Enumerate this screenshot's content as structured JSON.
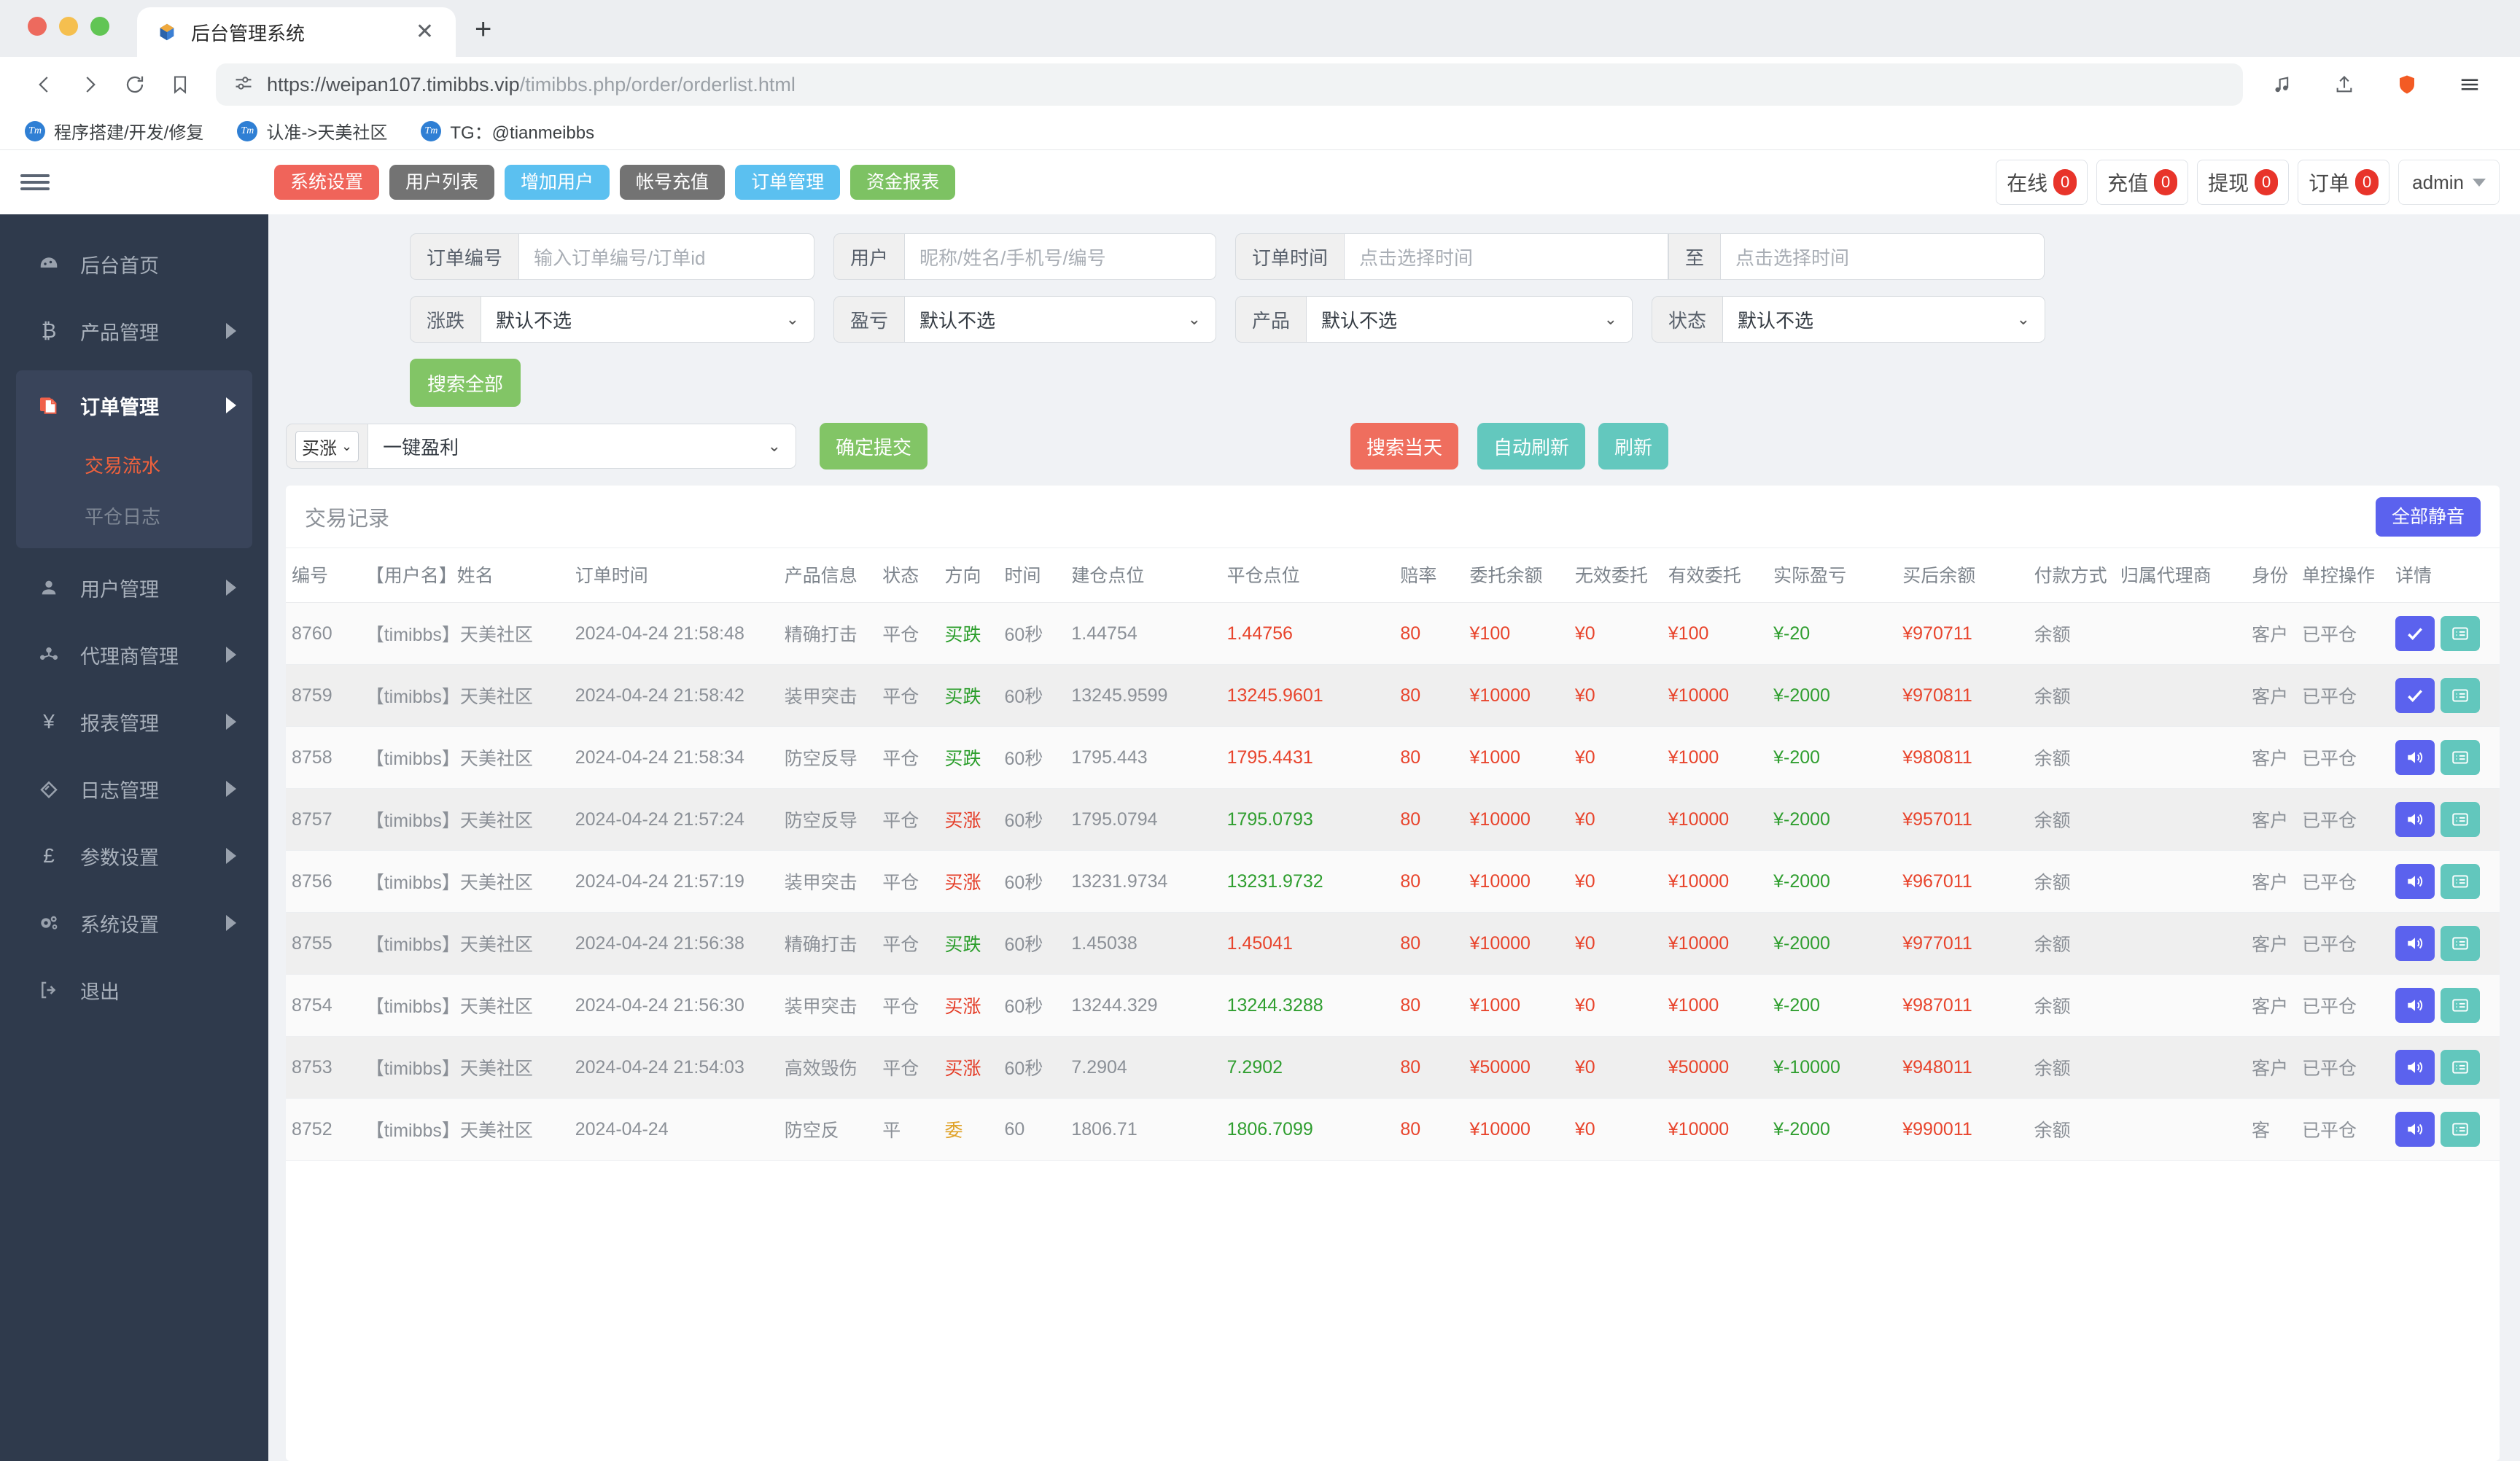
{
  "browser": {
    "tab_title": "后台管理系统",
    "tab_close": "✕",
    "new_tab": "+",
    "url_main": "https://weipan107.timibbs.vip",
    "url_path": "/timibbs.php/order/orderlist.html",
    "bookmarks": [
      {
        "icon": "Tm",
        "label": "程序搭建/开发/修复"
      },
      {
        "icon": "Tm",
        "label": "认准->天美社区"
      },
      {
        "icon": "Tm",
        "label": "TG：@tianmeibbs"
      }
    ]
  },
  "topbar": {
    "nav_buttons": [
      {
        "label": "系统设置",
        "color": "#f0645a"
      },
      {
        "label": "用户列表",
        "color": "#737373"
      },
      {
        "label": "增加用户",
        "color": "#5bc0f0"
      },
      {
        "label": "帐号充值",
        "color": "#737373"
      },
      {
        "label": "订单管理",
        "color": "#5bc0f0"
      },
      {
        "label": "资金报表",
        "color": "#7dc263"
      }
    ],
    "stats": [
      {
        "label": "在线",
        "count": "0"
      },
      {
        "label": "充值",
        "count": "0"
      },
      {
        "label": "提现",
        "count": "0"
      },
      {
        "label": "订单",
        "count": "0"
      }
    ],
    "user": "admin"
  },
  "sidebar": {
    "items": [
      {
        "icon": "dashboard-icon",
        "glyph": "◔",
        "label": "后台首页",
        "arrow": false
      },
      {
        "icon": "bitcoin-icon",
        "glyph": "₿",
        "label": "产品管理",
        "arrow": true
      }
    ],
    "group": {
      "icon": "order-icon",
      "label": "订单管理",
      "sub": [
        {
          "label": "交易流水",
          "active": true
        },
        {
          "label": "平仓日志",
          "active": false
        }
      ]
    },
    "items2": [
      {
        "icon": "user-icon",
        "glyph": "👤",
        "label": "用户管理",
        "arrow": true
      },
      {
        "icon": "agent-icon",
        "glyph": "👥",
        "label": "代理商管理",
        "arrow": true
      },
      {
        "icon": "yen-icon",
        "glyph": "¥",
        "label": "报表管理",
        "arrow": true
      },
      {
        "icon": "log-icon",
        "glyph": "◇",
        "label": "日志管理",
        "arrow": true
      },
      {
        "icon": "pound-icon",
        "glyph": "£",
        "label": "参数设置",
        "arrow": true
      },
      {
        "icon": "gear-icon",
        "glyph": "⚙",
        "label": "系统设置",
        "arrow": true
      },
      {
        "icon": "logout-icon",
        "glyph": "⇥",
        "label": "退出",
        "arrow": false
      }
    ]
  },
  "filters": {
    "order_no_label": "订单编号",
    "order_no_placeholder": "输入订单编号/订单id",
    "user_label": "用户",
    "user_placeholder": "昵称/姓名/手机号/编号",
    "time_label": "订单时间",
    "time_start_placeholder": "点击选择时间",
    "time_to_label": "至",
    "time_end_placeholder": "点击选择时间",
    "updown_label": "涨跌",
    "updown_value": "默认不选",
    "pl_label": "盈亏",
    "pl_value": "默认不选",
    "product_label": "产品",
    "product_value": "默认不选",
    "status_label": "状态",
    "status_value": "默认不选",
    "search_all": "搜索全部",
    "dir_select": "买涨",
    "bulk_select": "一键盈利",
    "confirm_submit": "确定提交",
    "search_today": "搜索当天",
    "auto_refresh": "自动刷新",
    "refresh": "刷新"
  },
  "table": {
    "title": "交易记录",
    "mute_all": "全部静音",
    "headers": [
      "编号",
      "【用户名】姓名",
      "订单时间",
      "产品信息",
      "状态",
      "方向",
      "时间",
      "建仓点位",
      "平仓点位",
      "赔率",
      "委托余额",
      "无效委托",
      "有效委托",
      "实际盈亏",
      "买后余额",
      "付款方式",
      "归属代理商",
      "身份",
      "单控操作",
      "详情"
    ],
    "rows": [
      {
        "id": "8760",
        "user": "【timibbs】天美社区",
        "time": "2024-04-24 21:58:48",
        "product": "精确打击",
        "status": "平仓",
        "direction": "买跌",
        "dir_color": "green",
        "duration": "60秒",
        "open": "1.44754",
        "close": "1.44756",
        "close_color": "red",
        "odds": "80",
        "entrust": "¥100",
        "invalid": "¥0",
        "valid": "¥100",
        "pl": "¥-20",
        "pl_color": "green",
        "balance": "¥970711",
        "pay": "余额",
        "agent": "",
        "identity": "客户",
        "control": "已平仓",
        "action_icon": "check-icon"
      },
      {
        "id": "8759",
        "user": "【timibbs】天美社区",
        "time": "2024-04-24 21:58:42",
        "product": "装甲突击",
        "status": "平仓",
        "direction": "买跌",
        "dir_color": "green",
        "duration": "60秒",
        "open": "13245.9599",
        "close": "13245.9601",
        "close_color": "red",
        "odds": "80",
        "entrust": "¥10000",
        "invalid": "¥0",
        "valid": "¥10000",
        "pl": "¥-2000",
        "pl_color": "green",
        "balance": "¥970811",
        "pay": "余额",
        "agent": "",
        "identity": "客户",
        "control": "已平仓",
        "action_icon": "check-icon"
      },
      {
        "id": "8758",
        "user": "【timibbs】天美社区",
        "time": "2024-04-24 21:58:34",
        "product": "防空反导",
        "status": "平仓",
        "direction": "买跌",
        "dir_color": "green",
        "duration": "60秒",
        "open": "1795.443",
        "close": "1795.4431",
        "close_color": "red",
        "odds": "80",
        "entrust": "¥1000",
        "invalid": "¥0",
        "valid": "¥1000",
        "pl": "¥-200",
        "pl_color": "green",
        "balance": "¥980811",
        "pay": "余额",
        "agent": "",
        "identity": "客户",
        "control": "已平仓",
        "action_icon": "speaker-icon"
      },
      {
        "id": "8757",
        "user": "【timibbs】天美社区",
        "time": "2024-04-24 21:57:24",
        "product": "防空反导",
        "status": "平仓",
        "direction": "买涨",
        "dir_color": "red",
        "duration": "60秒",
        "open": "1795.0794",
        "close": "1795.0793",
        "close_color": "green",
        "odds": "80",
        "entrust": "¥10000",
        "invalid": "¥0",
        "valid": "¥10000",
        "pl": "¥-2000",
        "pl_color": "green",
        "balance": "¥957011",
        "pay": "余额",
        "agent": "",
        "identity": "客户",
        "control": "已平仓",
        "action_icon": "speaker-icon"
      },
      {
        "id": "8756",
        "user": "【timibbs】天美社区",
        "time": "2024-04-24 21:57:19",
        "product": "装甲突击",
        "status": "平仓",
        "direction": "买涨",
        "dir_color": "red",
        "duration": "60秒",
        "open": "13231.9734",
        "close": "13231.9732",
        "close_color": "green",
        "odds": "80",
        "entrust": "¥10000",
        "invalid": "¥0",
        "valid": "¥10000",
        "pl": "¥-2000",
        "pl_color": "green",
        "balance": "¥967011",
        "pay": "余额",
        "agent": "",
        "identity": "客户",
        "control": "已平仓",
        "action_icon": "speaker-icon"
      },
      {
        "id": "8755",
        "user": "【timibbs】天美社区",
        "time": "2024-04-24 21:56:38",
        "product": "精确打击",
        "status": "平仓",
        "direction": "买跌",
        "dir_color": "green",
        "duration": "60秒",
        "open": "1.45038",
        "close": "1.45041",
        "close_color": "red",
        "odds": "80",
        "entrust": "¥10000",
        "invalid": "¥0",
        "valid": "¥10000",
        "pl": "¥-2000",
        "pl_color": "green",
        "balance": "¥977011",
        "pay": "余额",
        "agent": "",
        "identity": "客户",
        "control": "已平仓",
        "action_icon": "speaker-icon"
      },
      {
        "id": "8754",
        "user": "【timibbs】天美社区",
        "time": "2024-04-24 21:56:30",
        "product": "装甲突击",
        "status": "平仓",
        "direction": "买涨",
        "dir_color": "red",
        "duration": "60秒",
        "open": "13244.329",
        "close": "13244.3288",
        "close_color": "green",
        "odds": "80",
        "entrust": "¥1000",
        "invalid": "¥0",
        "valid": "¥1000",
        "pl": "¥-200",
        "pl_color": "green",
        "balance": "¥987011",
        "pay": "余额",
        "agent": "",
        "identity": "客户",
        "control": "已平仓",
        "action_icon": "speaker-icon"
      },
      {
        "id": "8753",
        "user": "【timibbs】天美社区",
        "time": "2024-04-24 21:54:03",
        "product": "高效毁伤",
        "status": "平仓",
        "direction": "买涨",
        "dir_color": "red",
        "duration": "60秒",
        "open": "7.2904",
        "close": "7.2902",
        "close_color": "green",
        "odds": "80",
        "entrust": "¥50000",
        "invalid": "¥0",
        "valid": "¥50000",
        "pl": "¥-10000",
        "pl_color": "green",
        "balance": "¥948011",
        "pay": "余额",
        "agent": "",
        "identity": "客户",
        "control": "已平仓",
        "action_icon": "speaker-icon"
      },
      {
        "id": "8752",
        "user": "【timibbs】天美社区",
        "time": "2024-04-24",
        "time2": "",
        "product": "防空反",
        "status": "平",
        "direction": "委",
        "dir_color": "gold",
        "duration": "60",
        "open": "1806.71",
        "close": "1806.7099",
        "close_color": "green",
        "odds": "80",
        "entrust": "¥10000",
        "invalid": "¥0",
        "valid": "¥10000",
        "pl": "¥-2000",
        "pl_color": "green",
        "balance": "¥990011",
        "pay": "余额",
        "agent": "",
        "identity": "客",
        "control": "已平仓",
        "action_icon": "speaker-icon"
      }
    ]
  }
}
